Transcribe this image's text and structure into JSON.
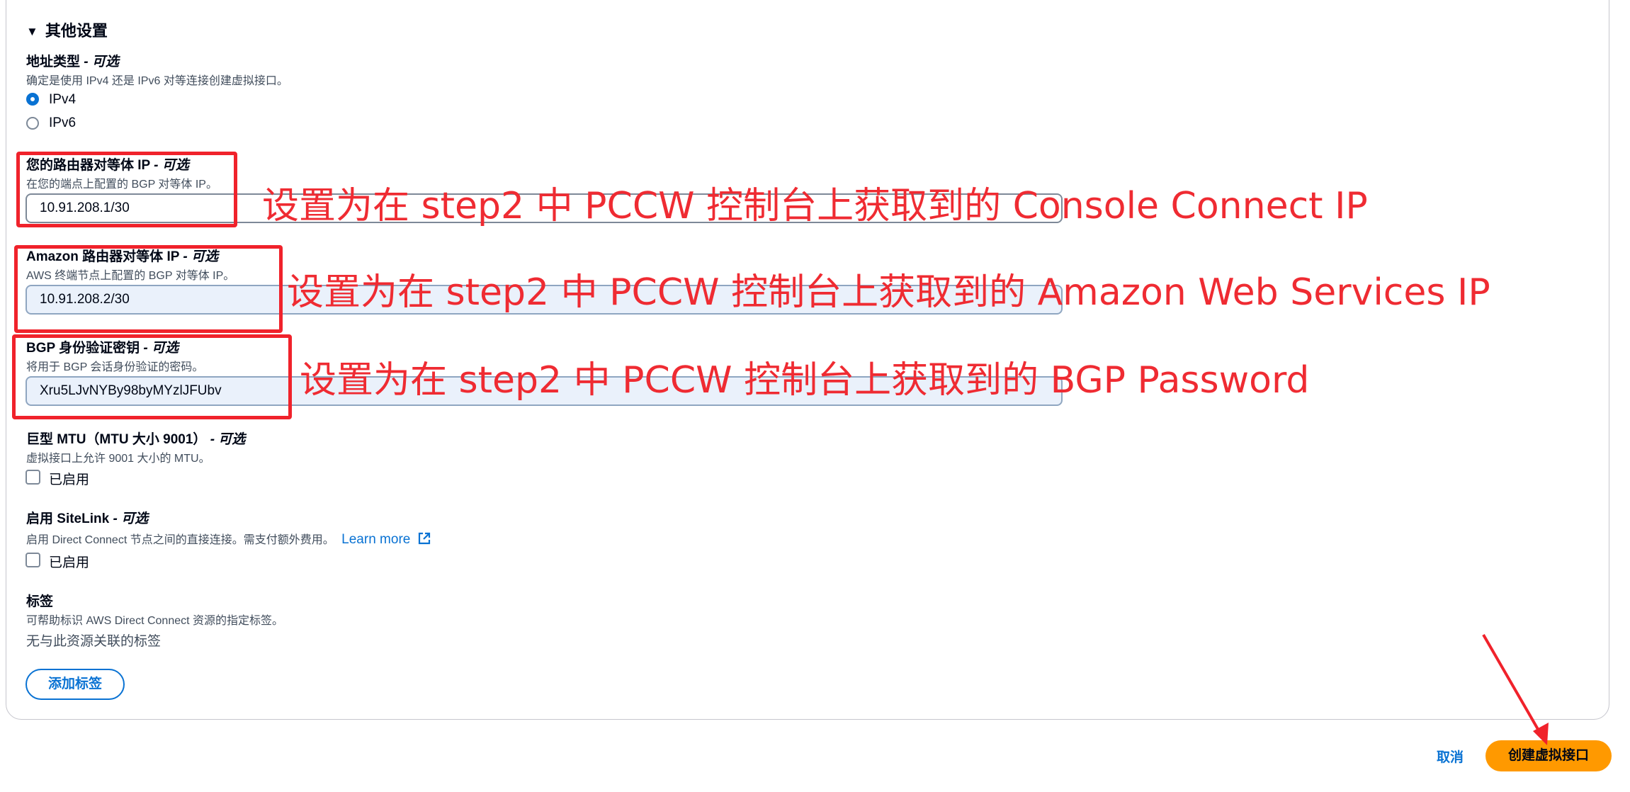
{
  "section": {
    "caret": "▼",
    "title": "其他设置"
  },
  "address_type": {
    "label": "地址类型",
    "optional": "- 可选",
    "description": "确定是使用 IPv4 还是 IPv6 对等连接创建虚拟接口。",
    "options": [
      {
        "label": "IPv4",
        "selected": true
      },
      {
        "label": "IPv6",
        "selected": false
      }
    ]
  },
  "router_peer_ip": {
    "label": "您的路由器对等体 IP",
    "optional": "- 可选",
    "description": "在您的端点上配置的 BGP 对等体 IP。",
    "value": "10.91.208.1/30"
  },
  "amazon_peer_ip": {
    "label": "Amazon 路由器对等体 IP",
    "optional": "- 可选",
    "description": "AWS 终端节点上配置的 BGP 对等体 IP。",
    "value": "10.91.208.2/30"
  },
  "bgp_key": {
    "label": "BGP 身份验证密钥",
    "optional": "- 可选",
    "description": "将用于 BGP 会话身份验证的密码。",
    "value": "Xru5LJvNYBy98byMYzlJFUbv"
  },
  "jumbo_mtu": {
    "label": "巨型 MTU（MTU 大小 9001）",
    "optional": "- 可选",
    "description": "虚拟接口上允许 9001 大小的 MTU。",
    "checkbox_label": "已启用",
    "checked": false
  },
  "sitelink": {
    "label": "启用 SiteLink",
    "optional": "- 可选",
    "description": "启用 Direct Connect 节点之间的直接连接。需支付额外费用。",
    "learn_more": "Learn more",
    "checkbox_label": "已启用",
    "checked": false
  },
  "tags": {
    "label": "标签",
    "description": "可帮助标识 AWS Direct Connect 资源的指定标签。",
    "empty_text": "无与此资源关联的标签",
    "add_button": "添加标签"
  },
  "footer": {
    "cancel": "取消",
    "create": "创建虚拟接口"
  },
  "annotations": {
    "router_ip_note": "设置为在 step2 中 PCCW 控制台上获取到的 Console Connect IP",
    "amazon_ip_note": "设置为在 step2 中 PCCW 控制台上获取到的 Amazon Web Services IP",
    "bgp_note": "设置为在 step2 中 PCCW 控制台上获取到的 BGP Password"
  },
  "colors": {
    "accent": "#0972d3",
    "primary_button": "#ff9900",
    "annotation_red": "#f0222b",
    "input_filled_bg": "#eaf1fb"
  }
}
